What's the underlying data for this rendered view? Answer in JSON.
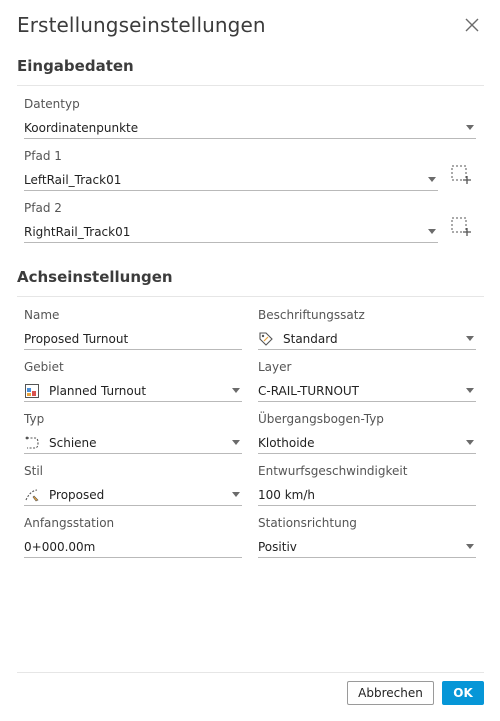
{
  "dialog": {
    "title": "Erstellungseinstellungen"
  },
  "input_section": {
    "title": "Eingabedaten",
    "datatype": {
      "label": "Datentyp",
      "value": "Koordinatenpunkte"
    },
    "path1": {
      "label": "Pfad 1",
      "value": "LeftRail_Track01"
    },
    "path2": {
      "label": "Pfad 2",
      "value": "RightRail_Track01"
    }
  },
  "axis_section": {
    "title": "Achseinstellungen",
    "name": {
      "label": "Name",
      "value": "Proposed Turnout"
    },
    "label_set": {
      "label": "Beschriftungssatz",
      "value": "Standard",
      "icon": "label-tag-icon"
    },
    "site": {
      "label": "Gebiet",
      "value": "Planned Turnout",
      "icon": "site-icon"
    },
    "layer": {
      "label": "Layer",
      "value": "C-RAIL-TURNOUT"
    },
    "type": {
      "label": "Typ",
      "value": "Schiene",
      "icon": "rail-type-icon"
    },
    "spiral_type": {
      "label": "Übergangsbogen-Typ",
      "value": "Klothoide"
    },
    "style": {
      "label": "Stil",
      "value": "Proposed",
      "icon": "style-icon"
    },
    "design_speed": {
      "label": "Entwurfsgeschwindigkeit",
      "value": "100 km/h"
    },
    "start_station": {
      "label": "Anfangsstation",
      "value": "0+000.00m"
    },
    "station_direction": {
      "label": "Stationsrichtung",
      "value": "Positiv"
    }
  },
  "footer": {
    "cancel_label": "Abbrechen",
    "ok_label": "OK"
  },
  "colors": {
    "accent": "#0696d7",
    "text": "#3c3c3c",
    "underline": "#b9b9b9"
  }
}
